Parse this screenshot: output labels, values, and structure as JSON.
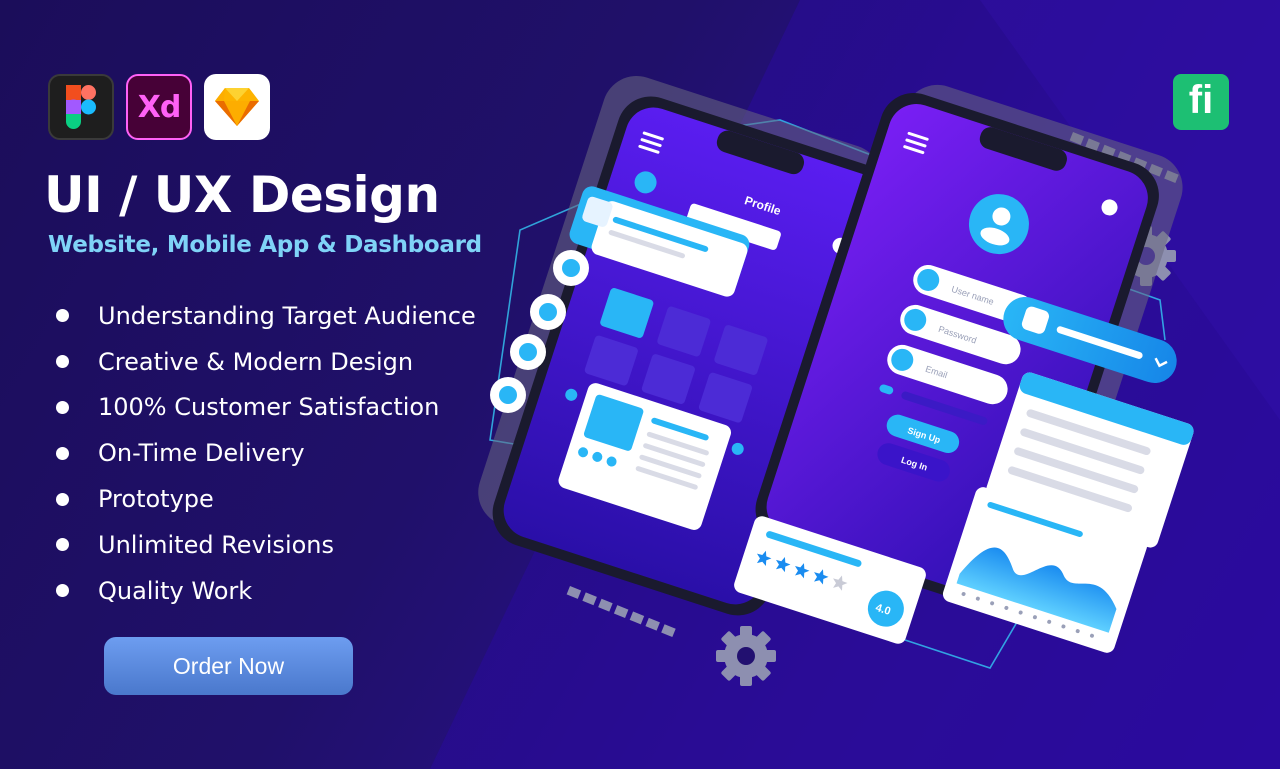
{
  "tools": [
    {
      "name": "Figma",
      "icon": "figma-icon"
    },
    {
      "name": "Adobe XD",
      "icon": "xd-icon",
      "label": "Xd"
    },
    {
      "name": "Sketch",
      "icon": "sketch-icon"
    }
  ],
  "title": "UI / UX Design",
  "subtitle": "Website, Mobile App & Dashboard",
  "features": [
    "Understanding Target Audience",
    "Creative & Modern Design",
    "100% Customer Satisfaction",
    "On-Time Delivery",
    "Prototype",
    "Unlimited Revisions",
    "Quality Work"
  ],
  "cta": {
    "label": "Order Now"
  },
  "brand": {
    "label": "fi",
    "icon": "fiverr-icon",
    "color": "#1dbf73"
  },
  "mockup": {
    "profile_title": "Profile",
    "fields": {
      "username": "User name",
      "password": "Password",
      "email": "Email"
    },
    "signup_label": "Sign Up",
    "login_label": "Log In",
    "rating_value": "4.0",
    "rating_stars": 4,
    "rating_max": 5
  },
  "colors": {
    "accent": "#1aa7f5",
    "background": "#1e0f63",
    "highlight": "#7fd3f7"
  }
}
